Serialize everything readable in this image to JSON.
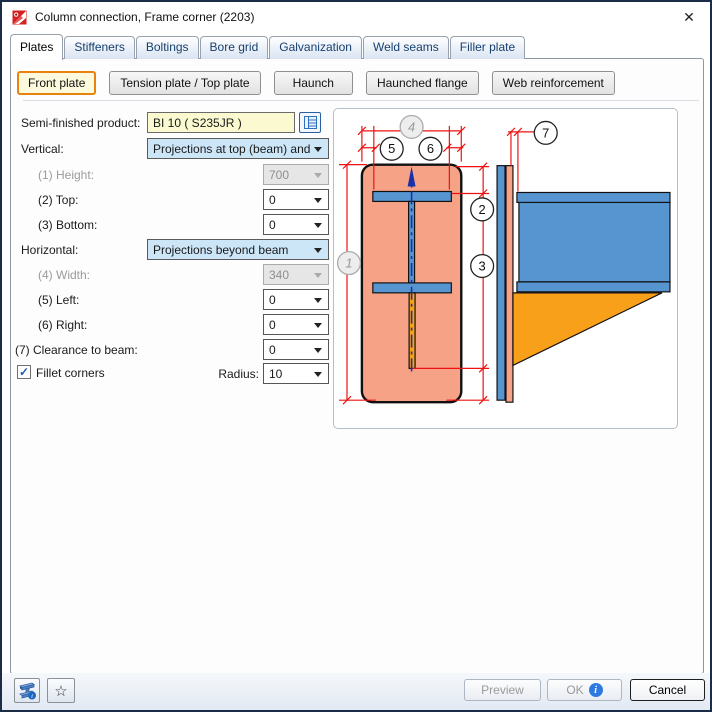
{
  "window": {
    "title": "Column connection, Frame corner (2203)"
  },
  "icons": {
    "close": "✕",
    "star": "☆",
    "check": "✓",
    "info": "i"
  },
  "tabs": [
    {
      "label": "Plates"
    },
    {
      "label": "Stiffeners"
    },
    {
      "label": "Boltings"
    },
    {
      "label": "Bore grid"
    },
    {
      "label": "Galvanization"
    },
    {
      "label": "Weld seams"
    },
    {
      "label": "Filler plate"
    }
  ],
  "plate_type_buttons": [
    {
      "label": "Front plate"
    },
    {
      "label": "Tension plate / Top plate"
    },
    {
      "label": "Haunch"
    },
    {
      "label": "Haunched flange"
    },
    {
      "label": "Web reinforcement"
    }
  ],
  "form": {
    "semi_finished_label": "Semi-finished product:",
    "semi_finished_value": "BI 10  ( S235JR )",
    "vertical_label": "Vertical:",
    "vertical_value": "Projections at top (beam) and",
    "height_label": "(1) Height:",
    "height_value": "700",
    "top_label": "(2) Top:",
    "top_value": "0",
    "bottom_label": "(3) Bottom:",
    "bottom_value": "0",
    "horizontal_label": "Horizontal:",
    "horizontal_value": "Projections beyond beam",
    "width_label": "(4) Width:",
    "width_value": "340",
    "left_label": "(5) Left:",
    "left_value": "0",
    "right_label": "(6) Right:",
    "right_value": "0",
    "clearance_label": "(7) Clearance to beam:",
    "clearance_value": "0",
    "fillet_label": "Fillet corners",
    "radius_label": "Radius:",
    "radius_value": "10"
  },
  "diagram": {
    "markers": [
      "1",
      "2",
      "3",
      "4",
      "5",
      "6",
      "7"
    ]
  },
  "footer": {
    "preview_label": "Preview",
    "ok_label": "OK",
    "cancel_label": "Cancel"
  },
  "colors": {
    "accent-orange": "#e8830d",
    "active-yellow": "#fcf9dc",
    "steel-blue": "#5795d1",
    "plate-salmon": "#f6a287",
    "haunch-orange": "#f9a01b",
    "dim-red": "#ee1111",
    "centerline-blue": "#1b2fa8",
    "highlight-blue": "#cce5f7",
    "field-yellow": "#faf9d0",
    "check-blue": "#1e5bb8"
  }
}
